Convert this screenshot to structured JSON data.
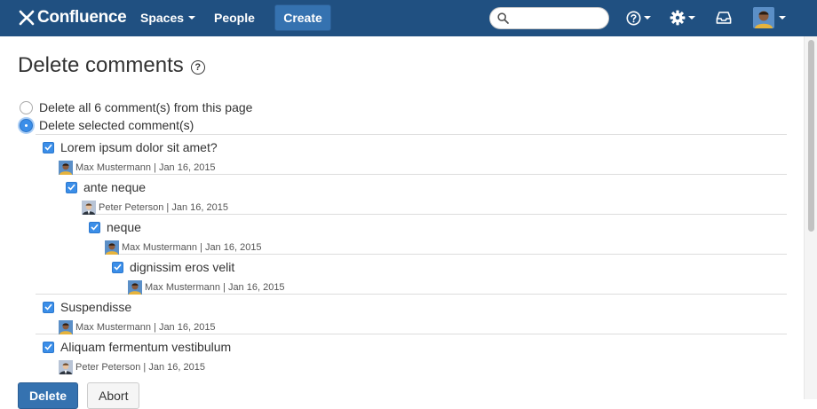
{
  "header": {
    "logo_text": "Confluence",
    "spaces_label": "Spaces",
    "people_label": "People",
    "create_label": "Create",
    "search_placeholder": ""
  },
  "page": {
    "title": "Delete comments",
    "help_glyph": "?"
  },
  "options": {
    "delete_all_label": "Delete all 6 comment(s) from this page",
    "delete_selected_label": "Delete selected comment(s)",
    "selected": "delete_selected"
  },
  "comments": [
    {
      "text": "Lorem ipsum dolor sit amet?",
      "meta": "Max Mustermann | Jan 16, 2015",
      "checked": true,
      "avatar": "max"
    },
    {
      "text": "ante neque",
      "meta": "Peter Peterson | Jan 16, 2015",
      "checked": true,
      "avatar": "peter"
    },
    {
      "text": "neque",
      "meta": "Max Mustermann | Jan 16, 2015",
      "checked": true,
      "avatar": "max"
    },
    {
      "text": "dignissim eros velit",
      "meta": "Max Mustermann | Jan 16, 2015",
      "checked": true,
      "avatar": "max"
    },
    {
      "text": "Suspendisse",
      "meta": "Max Mustermann | Jan 16, 2015",
      "checked": true,
      "avatar": "max"
    },
    {
      "text": "Aliquam fermentum vestibulum",
      "meta": "Peter Peterson | Jan 16, 2015",
      "checked": true,
      "avatar": "peter"
    }
  ],
  "buttons": {
    "delete_label": "Delete",
    "abort_label": "Abort"
  },
  "colors": {
    "header_bg": "#205081",
    "primary": "#3572b0",
    "checkbox": "#3b8ee8"
  },
  "icons": {
    "logo": "confluence-x-icon",
    "search": "search-icon",
    "help": "help-icon",
    "settings": "gear-icon",
    "notifications": "inbox-tray-icon",
    "user": "user-avatar"
  }
}
